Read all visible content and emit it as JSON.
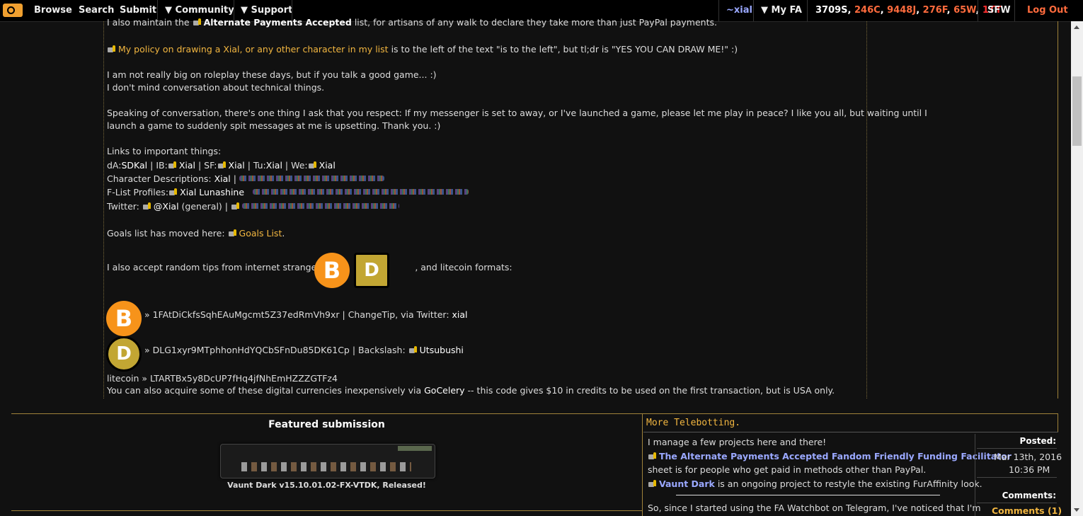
{
  "nav": {
    "browse": "Browse",
    "search": "Search",
    "submit": "Submit",
    "community": "Community",
    "support": "Support",
    "user": "~xial",
    "myfa": "My FA",
    "stats": {
      "s": "3709S",
      "c": "246C",
      "j": "9448J",
      "f": "276F",
      "w": "65W",
      "tt": "1TT"
    },
    "sfw": "SFW",
    "logout": "Log Out"
  },
  "profile": {
    "line_apa_pre": "I also maintain the",
    "line_apa_link": "Alternate Payments Accepted",
    "line_apa_post": "list, for artisans of any walk to declare they take more than just PayPal payments.",
    "policy_link": "My policy on drawing a Xial, or any other character in my list",
    "policy_post": "is to the left of the text \"is to the left\", but tl;dr is \"YES YOU CAN DRAW ME!\" :)",
    "roleplay": "I am not really big on roleplay these days, but if you talk a good game... :)",
    "technical": "I don't mind conversation about technical things.",
    "convo1": "Speaking of conversation, there's one thing I ask that you respect: If my messenger is set to away, or I've launched a game, please let me play in peace? I like you all, but waiting until I",
    "convo2": "launch a game to suddenly spit messages at me is upsetting. Thank you. :)",
    "links_heading": "Links to important things:",
    "da_label": "dA:",
    "da_val": "SDKal",
    "ib_label": "| IB:",
    "ib_val": "Xial",
    "sf_label": "| SF:",
    "sf_val": "Xial",
    "tu_label": "| Tu:",
    "tu_val": "Xial",
    "we_label": "| We:",
    "we_val": "Xial",
    "chardesc_label": "Character Descriptions:",
    "chardesc_val": "Xial",
    "flist_label": "F-List Profiles:",
    "flist_val": "Xial Lunashine",
    "twitter_label": "Twitter:",
    "twitter_val": "@Xial",
    "twitter_post": "(general) |",
    "goals_pre": "Goals list has moved here:",
    "goals_link": "Goals List",
    "goals_dot": ".",
    "tips_pre": "I also accept random tips from internet strangers in",
    "tips_comma": ",",
    "tips_post": ", and litecoin formats:",
    "btc_addr": "» 1FAtDiCkfsSqhEAuMgcmt5Z37edRmVh9xr | ChangeTip, via Twitter:",
    "btc_twitter": "xial",
    "doge_addr": "» DLG1xyr9MTphhonHdYQCbSFnDu85DK61Cp | Backslash:",
    "doge_user": "Utsubushi",
    "ltc_line": "litecoin » LTARTBx5y8DcUP7fHq4jfNhEmHZZZGTFz4",
    "gocelery_pre": "You can also acquire some of these digital currencies inexpensively via",
    "gocelery_link": "GoCelery",
    "gocelery_post": "-- this code gives $10 in credits to be used on the first transaction, but is USA only."
  },
  "featured": {
    "title": "Featured submission",
    "caption": "Vaunt Dark v15.10.01.02-FX-VTDK, Released!"
  },
  "journal": {
    "title": "More Telebotting.",
    "line1": "I manage a few projects here and there!",
    "apa_link": "The Alternate Payments Accepted Fandom Friendly Funding Facilitator",
    "apa_post": "sheet is for people who get paid in methods other than PayPal.",
    "vaunt_link": "Vaunt Dark",
    "vaunt_post": "is an ongoing project to restyle the existing FurAffinity look.",
    "para2": "So, since I started using the FA Watchbot on Telegram, I've noticed that I'm",
    "posted_label": "Posted:",
    "posted_date": "Mar 13th, 2016",
    "posted_time": "10:36 PM",
    "comments_label": "Comments:",
    "comments_link": "Comments (1)"
  },
  "colors": {
    "accent": "#f2b640",
    "border": "#a0823a",
    "stat_red": "#ff6b3d",
    "link_blue": "#9aa8ff"
  }
}
